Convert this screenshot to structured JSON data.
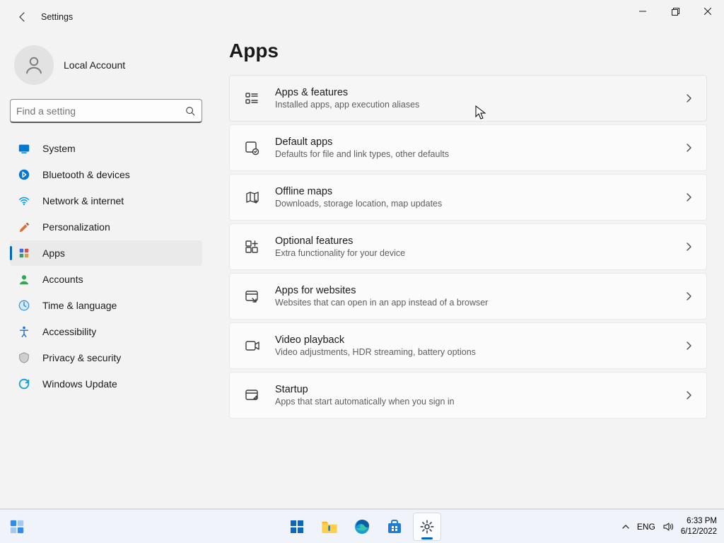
{
  "window": {
    "back_icon": "arrow-left",
    "title": "Settings"
  },
  "profile": {
    "name": "Local Account"
  },
  "search": {
    "placeholder": "Find a setting"
  },
  "nav": [
    {
      "id": "system",
      "label": "System",
      "iconColor": "#0078d4"
    },
    {
      "id": "bluetooth",
      "label": "Bluetooth & devices",
      "iconColor": "#0078d4"
    },
    {
      "id": "network",
      "label": "Network & internet",
      "iconColor": "#0099ee"
    },
    {
      "id": "personalization",
      "label": "Personalization",
      "iconColor": "#e07030"
    },
    {
      "id": "apps",
      "label": "Apps",
      "iconColor": "#7057d0",
      "selected": true
    },
    {
      "id": "accounts",
      "label": "Accounts",
      "iconColor": "#2fa84f"
    },
    {
      "id": "time",
      "label": "Time & language",
      "iconColor": "#2b8fd6"
    },
    {
      "id": "accessibility",
      "label": "Accessibility",
      "iconColor": "#1a6fd8"
    },
    {
      "id": "privacy",
      "label": "Privacy & security",
      "iconColor": "#8b8b8b"
    },
    {
      "id": "update",
      "label": "Windows Update",
      "iconColor": "#0fa1da"
    }
  ],
  "page": {
    "heading": "Apps",
    "items": [
      {
        "id": "apps-features",
        "title": "Apps & features",
        "subtitle": "Installed apps, app execution aliases",
        "hover": true
      },
      {
        "id": "default-apps",
        "title": "Default apps",
        "subtitle": "Defaults for file and link types, other defaults"
      },
      {
        "id": "offline-maps",
        "title": "Offline maps",
        "subtitle": "Downloads, storage location, map updates"
      },
      {
        "id": "optional-feat",
        "title": "Optional features",
        "subtitle": "Extra functionality for your device"
      },
      {
        "id": "apps-websites",
        "title": "Apps for websites",
        "subtitle": "Websites that can open in an app instead of a browser"
      },
      {
        "id": "video-playback",
        "title": "Video playback",
        "subtitle": "Video adjustments, HDR streaming, battery options"
      },
      {
        "id": "startup",
        "title": "Startup",
        "subtitle": "Apps that start automatically when you sign in"
      }
    ]
  },
  "taskbar": {
    "lang": "ENG",
    "time": "6:33 PM",
    "date": "6/12/2022"
  }
}
